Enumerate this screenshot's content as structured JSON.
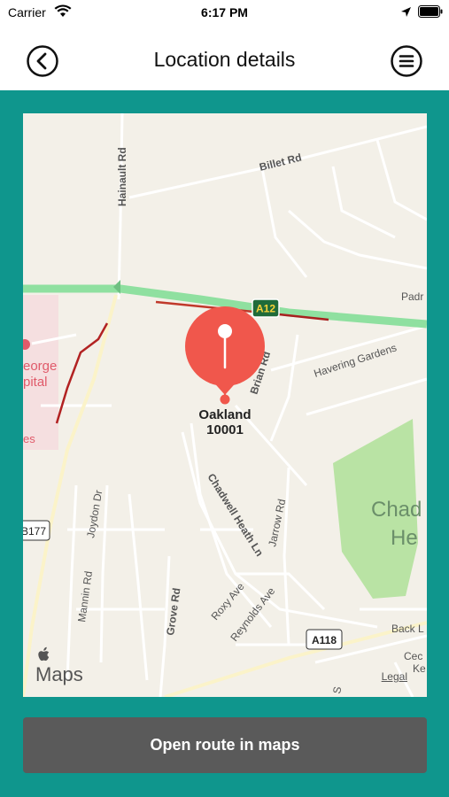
{
  "status_bar": {
    "carrier": "Carrier",
    "time": "6:17 PM"
  },
  "nav": {
    "title": "Location details",
    "back_icon": "back-circle-icon",
    "menu_icon": "menu-circle-icon"
  },
  "map": {
    "pin": {
      "name": "Oakland",
      "code": "10001",
      "color": "#f0574c"
    },
    "road_labels": {
      "hainault": "Hainault Rd",
      "billet": "Billet Rd",
      "a12": "A12",
      "brian": "Brian Rd",
      "havering": "Havering Gardens",
      "chadwell_ln": "Chadwell Heath Ln",
      "joydon": "Joydon Dr",
      "jarrow": "Jarrow Rd",
      "mannin": "Mannin Rd",
      "grove": "Grove Rd",
      "roxy": "Roxy Ave",
      "reynolds": "Reynolds Ave",
      "a118": "A118",
      "b177": "B177",
      "back": "Back L",
      "padr": "Padr",
      "george": "eorge",
      "pital": "pital",
      "es": "es",
      "chad": "Chad",
      "he": "He",
      "cec": "Cec",
      "ke": "Ke",
      "s": "S"
    },
    "attribution": "Maps",
    "legal": "Legal"
  },
  "route_button": {
    "label": "Open route in maps"
  },
  "colors": {
    "teal_background": "#0f968d",
    "map_land": "#f3f0e8",
    "park": "#b9e3a4",
    "highway": "#8fe0a0",
    "button": "#5a5a5a"
  }
}
